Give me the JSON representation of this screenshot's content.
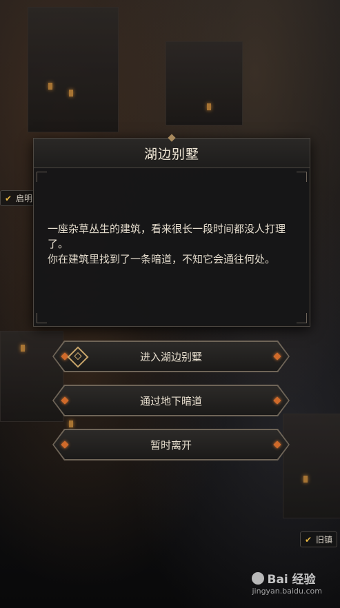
{
  "dialog": {
    "title": "湖边别墅",
    "body_line1": "一座杂草丛生的建筑，看来很长一段时间都没人打理了。",
    "body_line2": "你在建筑里找到了一条暗道，不知它会通往何处。"
  },
  "options": [
    {
      "label": "进入湖边别墅"
    },
    {
      "label": "通过地下暗道"
    },
    {
      "label": "暂时离开"
    }
  ],
  "map_tags": [
    {
      "label": "启明"
    },
    {
      "label": "旧镇"
    }
  ],
  "watermark": {
    "brand": "Bai 经验",
    "url": "jingyan.baidu.com"
  },
  "colors": {
    "accent_gold": "#c9a66b",
    "gem_orange": "#d06a2a",
    "check_yellow": "#e6b642",
    "panel_bg": "#161617"
  }
}
